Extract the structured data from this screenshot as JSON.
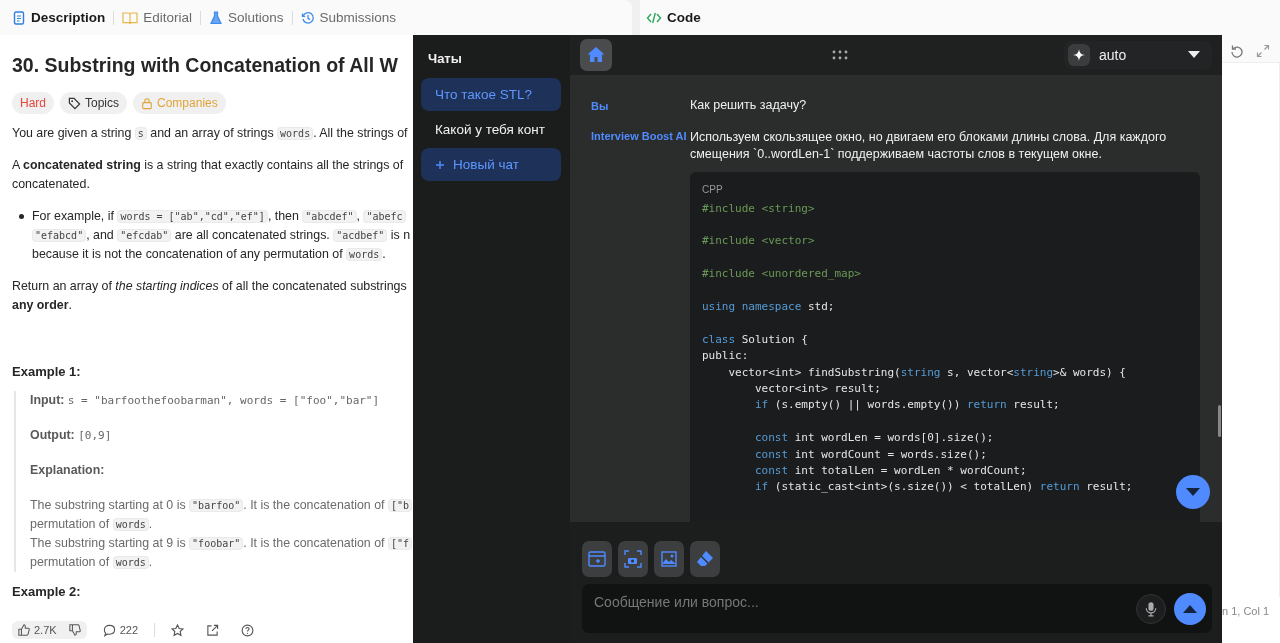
{
  "left_tabs": [
    {
      "label": "Description",
      "selected": true
    },
    {
      "label": "Editorial",
      "selected": false
    },
    {
      "label": "Solutions",
      "selected": false
    },
    {
      "label": "Submissions",
      "selected": false
    }
  ],
  "code_tab": {
    "label": "Code"
  },
  "problem": {
    "title": "30. Substring with Concatenation of All W",
    "tags": [
      {
        "label": "Hard",
        "kind": "difficulty"
      },
      {
        "label": "Topics",
        "kind": "topics"
      },
      {
        "label": "Companies",
        "kind": "companies"
      }
    ],
    "paragraphs": [
      {
        "kind": "text",
        "lines": [
          [
            {
              "text": "You are given a string ",
              "kind": "plain"
            },
            {
              "text": "s",
              "kind": "code"
            },
            {
              "text": " and an array of strings ",
              "kind": "plain"
            },
            {
              "text": "words",
              "kind": "code"
            },
            {
              "text": ". All the strings of",
              "kind": "plain"
            }
          ]
        ]
      },
      {
        "kind": "text",
        "lines": [
          [
            {
              "text": "A ",
              "kind": "plain"
            },
            {
              "text": "concatenated string",
              "kind": "bold"
            },
            {
              "text": " is a string that exactly contains all the strings of",
              "kind": "plain"
            }
          ],
          [
            {
              "text": "concatenated.",
              "kind": "plain"
            }
          ]
        ]
      },
      {
        "kind": "bullet",
        "lines": [
          [
            {
              "text": "For example, if ",
              "kind": "plain"
            },
            {
              "text": "words = [\"ab\",\"cd\",\"ef\"]",
              "kind": "code"
            },
            {
              "text": ", then ",
              "kind": "plain"
            },
            {
              "text": "\"abcdef\"",
              "kind": "code"
            },
            {
              "text": ", ",
              "kind": "plain"
            },
            {
              "text": "\"abefc",
              "kind": "code"
            }
          ],
          [
            {
              "text": "\"efabcd\"",
              "kind": "code"
            },
            {
              "text": ", and ",
              "kind": "plain"
            },
            {
              "text": "\"efcdab\"",
              "kind": "code"
            },
            {
              "text": " are all concatenated strings. ",
              "kind": "plain"
            },
            {
              "text": "\"acdbef\"",
              "kind": "code"
            },
            {
              "text": " is n",
              "kind": "plain"
            }
          ],
          [
            {
              "text": "because it is not the concatenation of any permutation of ",
              "kind": "plain"
            },
            {
              "text": "words",
              "kind": "code"
            },
            {
              "text": ".",
              "kind": "plain"
            }
          ]
        ]
      },
      {
        "kind": "text",
        "lines": [
          [
            {
              "text": "Return an array of ",
              "kind": "plain"
            },
            {
              "text": "the starting indices",
              "kind": "italic"
            },
            {
              "text": " of all the concatenated substrings",
              "kind": "plain"
            }
          ],
          [
            {
              "text": "any order",
              "kind": "bold"
            },
            {
              "text": ".",
              "kind": "plain"
            }
          ]
        ]
      }
    ],
    "example_1": {
      "heading": "Example 1:",
      "input_label": "Input:",
      "input": "s = \"barfoothefoobarman\", words = [\"foo\",\"bar\"]",
      "output_label": "Output:",
      "output": "[0,9]",
      "explanation_label": "Explanation:",
      "explanation": [
        {
          "lines": [
            [
              {
                "text": "The substring starting at 0 is ",
                "kind": "plain"
              },
              {
                "text": "\"barfoo\"",
                "kind": "code"
              },
              {
                "text": ". It is the concatenation of ",
                "kind": "plain"
              },
              {
                "text": "[\"b",
                "kind": "code"
              }
            ],
            [
              {
                "text": "permutation of ",
                "kind": "plain"
              },
              {
                "text": "words",
                "kind": "code"
              },
              {
                "text": ".",
                "kind": "plain"
              }
            ]
          ]
        },
        {
          "lines": [
            [
              {
                "text": "The substring starting at 9 is ",
                "kind": "plain"
              },
              {
                "text": "\"foobar\"",
                "kind": "code"
              },
              {
                "text": ". It is the concatenation of ",
                "kind": "plain"
              },
              {
                "text": "[\"f",
                "kind": "code"
              }
            ],
            [
              {
                "text": "permutation of ",
                "kind": "plain"
              },
              {
                "text": "words",
                "kind": "code"
              },
              {
                "text": ".",
                "kind": "plain"
              }
            ]
          ]
        }
      ]
    },
    "example_2": {
      "heading": "Example 2:"
    },
    "footer": {
      "likes": "2.7K",
      "comments": "222"
    }
  },
  "chat_sidebar": {
    "title": "Чаты",
    "chats": [
      {
        "label": "Что такое STL?",
        "selected": true
      },
      {
        "label": "Какой у тебя конт",
        "selected": false
      }
    ],
    "new_chat": "Новый чат"
  },
  "chat": {
    "model": "auto",
    "messages": [
      {
        "role": "Вы",
        "kind": "user",
        "text": "Как решить задачу?"
      },
      {
        "role": "Interview Boost AI",
        "kind": "assistant",
        "text": "Используем скользящее окно, но двигаем его блоками длины слова. Для каждого смещения `0..wordLen-1` поддерживаем частоты слов в текущем окне.",
        "code": {
          "language": "CPP",
          "lines": [
            {
              "kind": "code",
              "tokens": [
                {
                  "text": "#include <string>",
                  "kind": "directive"
                }
              ]
            },
            {
              "kind": "blank"
            },
            {
              "kind": "code",
              "tokens": [
                {
                  "text": "#include <vector>",
                  "kind": "directive"
                }
              ]
            },
            {
              "kind": "blank"
            },
            {
              "kind": "code",
              "tokens": [
                {
                  "text": "#include <unordered_map>",
                  "kind": "directive"
                }
              ]
            },
            {
              "kind": "blank"
            },
            {
              "kind": "code",
              "tokens": [
                {
                  "text": "using namespace",
                  "kind": "keyword"
                },
                {
                  "text": " std;",
                  "kind": "plain"
                }
              ]
            },
            {
              "kind": "blank"
            },
            {
              "kind": "code",
              "tokens": [
                {
                  "text": "class",
                  "kind": "keyword"
                },
                {
                  "text": " Solution {",
                  "kind": "plain"
                }
              ]
            },
            {
              "kind": "code",
              "tokens": [
                {
                  "text": "public:",
                  "kind": "plain"
                }
              ]
            },
            {
              "kind": "code",
              "tokens": [
                {
                  "text": "    vector<int> findSubstring(",
                  "kind": "plain"
                },
                {
                  "text": "string",
                  "kind": "keyword"
                },
                {
                  "text": " s, vector<",
                  "kind": "plain"
                },
                {
                  "text": "string",
                  "kind": "keyword"
                },
                {
                  "text": ">& words) {",
                  "kind": "plain"
                }
              ]
            },
            {
              "kind": "code",
              "tokens": [
                {
                  "text": "        vector<int> result;",
                  "kind": "plain"
                }
              ]
            },
            {
              "kind": "code",
              "tokens": [
                {
                  "text": "        if",
                  "kind": "keyword"
                },
                {
                  "text": " (s.empty() || words.empty()) ",
                  "kind": "plain"
                },
                {
                  "text": "return",
                  "kind": "keyword"
                },
                {
                  "text": " result;",
                  "kind": "plain"
                }
              ]
            },
            {
              "kind": "blank"
            },
            {
              "kind": "code",
              "tokens": [
                {
                  "text": "        const",
                  "kind": "keyword"
                },
                {
                  "text": " int wordLen = words[0].size();",
                  "kind": "plain"
                }
              ]
            },
            {
              "kind": "code",
              "tokens": [
                {
                  "text": "        const",
                  "kind": "keyword"
                },
                {
                  "text": " int wordCount = words.size();",
                  "kind": "plain"
                }
              ]
            },
            {
              "kind": "code",
              "tokens": [
                {
                  "text": "        const",
                  "kind": "keyword"
                },
                {
                  "text": " int totalLen = wordLen * wordCount;",
                  "kind": "plain"
                }
              ]
            },
            {
              "kind": "code",
              "tokens": [
                {
                  "text": "        if",
                  "kind": "keyword"
                },
                {
                  "text": " (static_cast<int>(s.size()) < totalLen) ",
                  "kind": "plain"
                },
                {
                  "text": "return",
                  "kind": "keyword"
                },
                {
                  "text": " result;",
                  "kind": "plain"
                }
              ]
            }
          ]
        }
      }
    ],
    "input": {
      "placeholder": "Сообщение или вопрос..."
    }
  },
  "editor_status": {
    "position": "n 1, Col 1"
  }
}
